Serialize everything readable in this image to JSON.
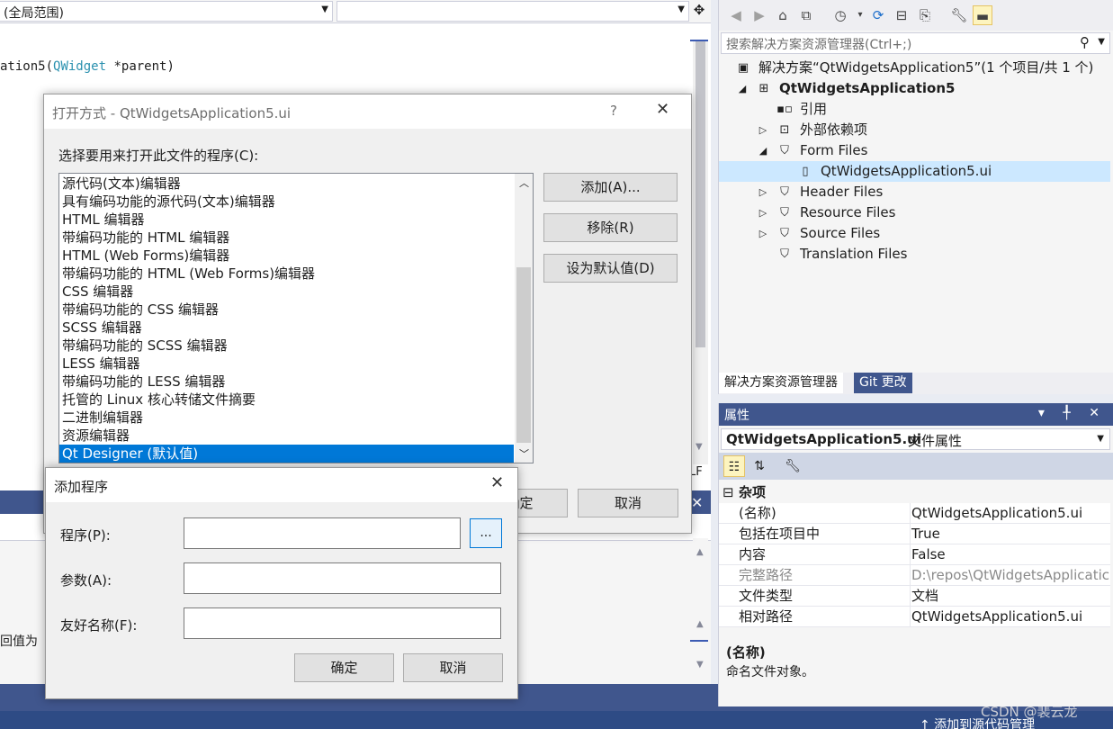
{
  "editor": {
    "scope_combo": "(全局范围)",
    "scope_combo_arrow": "▾",
    "code_prefix": "ation5(",
    "code_type": "QWidget",
    "code_suffix": " *parent)",
    "status_lf": "LF",
    "split_icon": "split-icon"
  },
  "bottom_tool": {
    "close": "✕",
    "text": "回值为"
  },
  "status_bar": {
    "add_to_source_control": "↑  添加到源代码管理",
    "watermark": "CSDN @裴云龙"
  },
  "solution_explorer": {
    "search_placeholder": "搜索解决方案资源管理器(Ctrl+;)",
    "tree": [
      {
        "label": "解决方案“QtWidgetsApplication5”(1 个项目/共 1 个)",
        "icon": "solution-icon",
        "glyph": "▣",
        "indent": 0,
        "expander": "",
        "bold": false,
        "selected": false
      },
      {
        "label": "QtWidgetsApplication5",
        "icon": "qt-project-icon",
        "glyph": "⊞",
        "indent": 1,
        "expander": "◢",
        "bold": true,
        "selected": false
      },
      {
        "label": "引用",
        "icon": "references-icon",
        "glyph": "▪▫",
        "indent": 2,
        "expander": "",
        "bold": false,
        "selected": false
      },
      {
        "label": "外部依赖项",
        "icon": "external-deps-icon",
        "glyph": "⊡",
        "indent": 2,
        "expander": "▷",
        "bold": false,
        "selected": false
      },
      {
        "label": "Form Files",
        "icon": "filter-folder-icon",
        "glyph": "⛉",
        "indent": 2,
        "expander": "◢",
        "bold": false,
        "selected": false
      },
      {
        "label": "QtWidgetsApplication5.ui",
        "icon": "ui-file-icon",
        "glyph": "▯",
        "indent": 3,
        "expander": "",
        "bold": false,
        "selected": true
      },
      {
        "label": "Header Files",
        "icon": "filter-folder-icon",
        "glyph": "⛉",
        "indent": 2,
        "expander": "▷",
        "bold": false,
        "selected": false
      },
      {
        "label": "Resource Files",
        "icon": "filter-folder-icon",
        "glyph": "⛉",
        "indent": 2,
        "expander": "▷",
        "bold": false,
        "selected": false
      },
      {
        "label": "Source Files",
        "icon": "filter-folder-icon",
        "glyph": "⛉",
        "indent": 2,
        "expander": "▷",
        "bold": false,
        "selected": false
      },
      {
        "label": "Translation Files",
        "icon": "filter-folder-icon",
        "glyph": "⛉",
        "indent": 2,
        "expander": "",
        "bold": false,
        "selected": false
      }
    ],
    "tabs": [
      "解决方案资源管理器",
      "Git 更改"
    ]
  },
  "properties": {
    "title": "属性",
    "header_icons": "▾ ╀ ✕",
    "object_name": "QtWidgetsApplication5.ui",
    "object_type": "文件属性",
    "category": "杂项",
    "category_expander": "⊟",
    "rows": [
      {
        "name": "(名称)",
        "value": "QtWidgetsApplication5.ui",
        "dim": false
      },
      {
        "name": "包括在项目中",
        "value": "True",
        "dim": false
      },
      {
        "name": "内容",
        "value": "False",
        "dim": false
      },
      {
        "name": "完整路径",
        "value": "D:\\repos\\QtWidgetsApplicatic",
        "dim": true
      },
      {
        "name": "文件类型",
        "value": "文档",
        "dim": false
      },
      {
        "name": "相对路径",
        "value": "QtWidgetsApplication5.ui",
        "dim": false
      }
    ],
    "desc_name": "(名称)",
    "desc_text": "命名文件对象。"
  },
  "open_with_dialog": {
    "title": "打开方式 - QtWidgetsApplication5.ui",
    "help": "?",
    "close": "✕",
    "prompt": "选择要用来打开此文件的程序(C):",
    "programs": [
      "源代码(文本)编辑器",
      "具有编码功能的源代码(文本)编辑器",
      "HTML 编辑器",
      "带编码功能的 HTML 编辑器",
      "HTML (Web Forms)编辑器",
      "带编码功能的 HTML (Web Forms)编辑器",
      "CSS 编辑器",
      "带编码功能的 CSS 编辑器",
      "SCSS 编辑器",
      "带编码功能的 SCSS 编辑器",
      "LESS 编辑器",
      "带编码功能的 LESS 编辑器",
      "托管的 Linux 核心转储文件摘要",
      "二进制编辑器",
      "资源编辑器",
      "Qt Designer (默认值)"
    ],
    "selected_index": 15,
    "add_label": "添加(A)...",
    "remove_label": "移除(R)",
    "set_default_label": "设为默认值(D)",
    "ok_label": "确定",
    "cancel_label": "取消"
  },
  "add_program_dialog": {
    "title": "添加程序",
    "close": "✕",
    "program_label": "程序(P):",
    "args_label": "参数(A):",
    "friendly_label": "友好名称(F):",
    "program_value": "",
    "args_value": "",
    "friendly_value": "",
    "browse_label": "...",
    "ok_label": "确定",
    "cancel_label": "取消"
  }
}
